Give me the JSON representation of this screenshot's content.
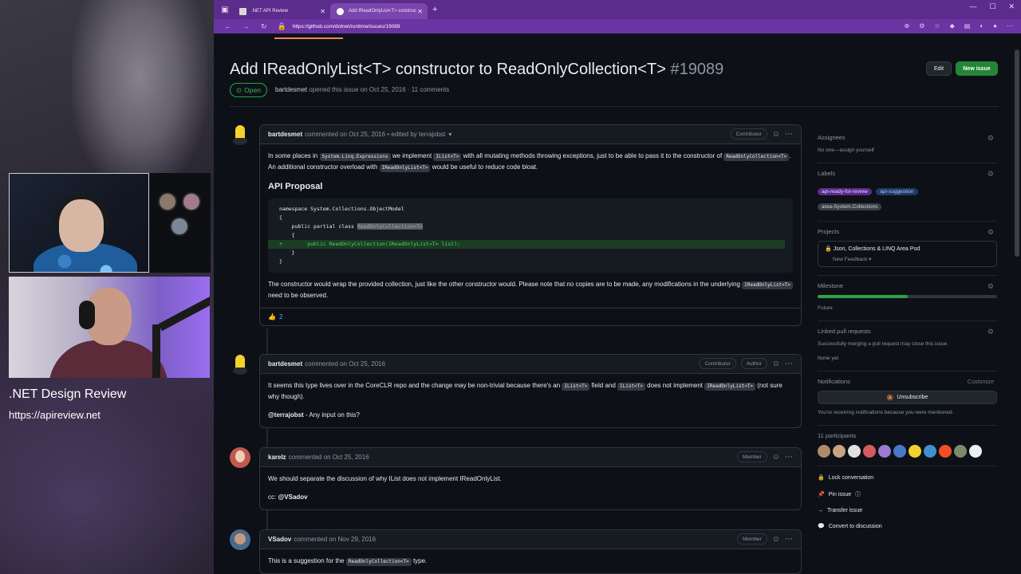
{
  "stream": {
    "show_title": ".NET Design Review",
    "show_url": "https://apireview.net"
  },
  "browser": {
    "tabs": [
      {
        "label": ".NET API Review",
        "active": false
      },
      {
        "label": "Add IReadOnlyList<T> construc",
        "active": true
      }
    ],
    "url": "https://github.com/dotnet/runtime/issues/19089",
    "theme_color": "#5b2c8c"
  },
  "issue": {
    "title": "Add IReadOnlyList<T> constructor to ReadOnlyCollection<T>",
    "number": "#19089",
    "state": "Open",
    "meta_author": "bartdesmet",
    "meta_rest": "opened this issue on Oct 25, 2016 · 11 comments",
    "edit_label": "Edit",
    "new_issue_label": "New issue"
  },
  "comments": [
    {
      "author": "bartdesmet",
      "when": "commented on Oct 25, 2016 • edited by terrajobst",
      "badges": [
        "Contributor"
      ],
      "p1_a": "In some places in",
      "p1_code1": "System.Linq.Expressions",
      "p1_b": "we implement",
      "p1_code2": "IList<T>",
      "p1_c": "with all mutating methods throwing exceptions, just to be able to pass it to the constructor of",
      "p1_code3": "ReadOnlyCollection<T>",
      "p1_d": ". An additional constructor overload with",
      "p1_code4": "IReadOnlyList<T>",
      "p1_e": "would be useful to reduce code bloat.",
      "heading": "API Proposal",
      "code_l1": "namespace System.Collections.ObjectModel",
      "code_l2": "{",
      "code_l3a": "    public partial class ",
      "code_l3b": "ReadOnlyCollection<T>",
      "code_l4": "    {",
      "code_l5": "+        public ReadOnlyCollection(IReadOnlyList<T> list);",
      "code_l6": "    }",
      "code_l7": "}",
      "p2_a": "The constructor would wrap the provided collection, just like the other constructor would. Please note that no copies are to be made, any modifications in the underlying",
      "p2_code": "IReadOnlyList<T>",
      "p2_b": "need to be observed.",
      "reaction_emoji": "👍",
      "reaction_count": "2"
    },
    {
      "author": "bartdesmet",
      "when": "commented on Oct 25, 2016",
      "badges": [
        "Contributor",
        "Author"
      ],
      "p1_a": "It seems this type lives over in the CoreCLR repo and the change may be non-trivial because there's an",
      "p1_code1": "IList<T>",
      "p1_b": "field and",
      "p1_code2": "IList<T>",
      "p1_c": "does not implement",
      "p1_code3": "IReadOnlyList<T>",
      "p1_d": "(not sure why though).",
      "mention": "@terrajobst",
      "p2": "- Any input on this?"
    },
    {
      "author": "karelz",
      "when": "commented on Oct 25, 2016",
      "badges": [
        "Member"
      ],
      "p1": "We should separate the discussion of why IList does not implement IReadOnlyList.",
      "p2_a": "cc:",
      "mention": "@VSadov"
    },
    {
      "author": "VSadov",
      "when": "commented on Nov 29, 2016",
      "badges": [
        "Member"
      ],
      "p1_a": "This is a suggestion for the",
      "p1_code": "ReadOnlyCollection<T>",
      "p1_b": "type."
    }
  ],
  "sidebar": {
    "assignees_title": "Assignees",
    "assignees_text": "No one—assign yourself",
    "labels_title": "Labels",
    "labels": [
      {
        "name": "api-ready-for-review",
        "color": "#7a45ad"
      },
      {
        "name": "api-suggestion",
        "color": "#1f4e8a"
      },
      {
        "name": "area-System.Collections",
        "color": "#3a3f46"
      }
    ],
    "projects_title": "Projects",
    "project_name": "Json, Collections & LINQ Area Pod",
    "project_status": "New Feedback",
    "milestone_title": "Milestone",
    "milestone_name": "Future",
    "milestone_progress": 0.5,
    "linked_title": "Linked pull requests",
    "linked_text": "Successfully merging a pull request may close this issue.",
    "linked_none": "None yet",
    "notifications_title": "Notifications",
    "customize": "Customize",
    "unsubscribe": "Unsubscribe",
    "notif_text": "You're receiving notifications because you were mentioned.",
    "participants_title": "11 participants",
    "participant_colors": [
      "#b08a6a",
      "#c9a27f",
      "#e0e0e0",
      "#d35d5d",
      "#9a7bd1",
      "#4a78c9",
      "#f2d22e",
      "#3f8fd1",
      "#f25022",
      "#7a8a6a",
      "#e8f0f0"
    ],
    "actions": [
      {
        "icon": "lock-icon",
        "label": "Lock conversation"
      },
      {
        "icon": "pin-icon",
        "label": "Pin issue"
      },
      {
        "icon": "arrow-right-icon",
        "label": "Transfer issue"
      },
      {
        "icon": "discussion-icon",
        "label": "Convert to discussion"
      }
    ]
  }
}
